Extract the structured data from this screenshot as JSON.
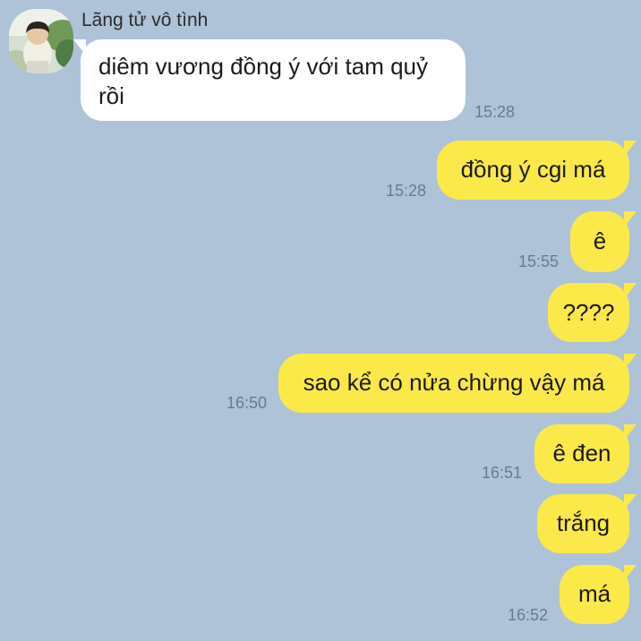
{
  "contact": {
    "name": "Lãng tử vô tình"
  },
  "messages": [
    {
      "direction": "in",
      "text_line1": "diêm vương đồng ý với tam quỷ",
      "text_line2": "rồi",
      "time": "15:28"
    },
    {
      "direction": "out",
      "text": "đồng ý cgi má",
      "time": "15:28"
    },
    {
      "direction": "out",
      "text": "ê",
      "time": "15:55"
    },
    {
      "direction": "out",
      "text": "????",
      "time": ""
    },
    {
      "direction": "out",
      "text": "sao kể có nửa chừng vậy má",
      "time": "16:50"
    },
    {
      "direction": "out",
      "text": "ê đen",
      "time": "16:51"
    },
    {
      "direction": "out",
      "text": "trắng",
      "time": ""
    },
    {
      "direction": "out",
      "text": "má",
      "time": "16:52"
    }
  ],
  "colors": {
    "background": "#aec3d8",
    "incoming_bubble": "#ffffff",
    "outgoing_bubble": "#fbe94a",
    "timestamp": "#6b7a88"
  },
  "icons": {
    "avatar": "profile-photo"
  }
}
